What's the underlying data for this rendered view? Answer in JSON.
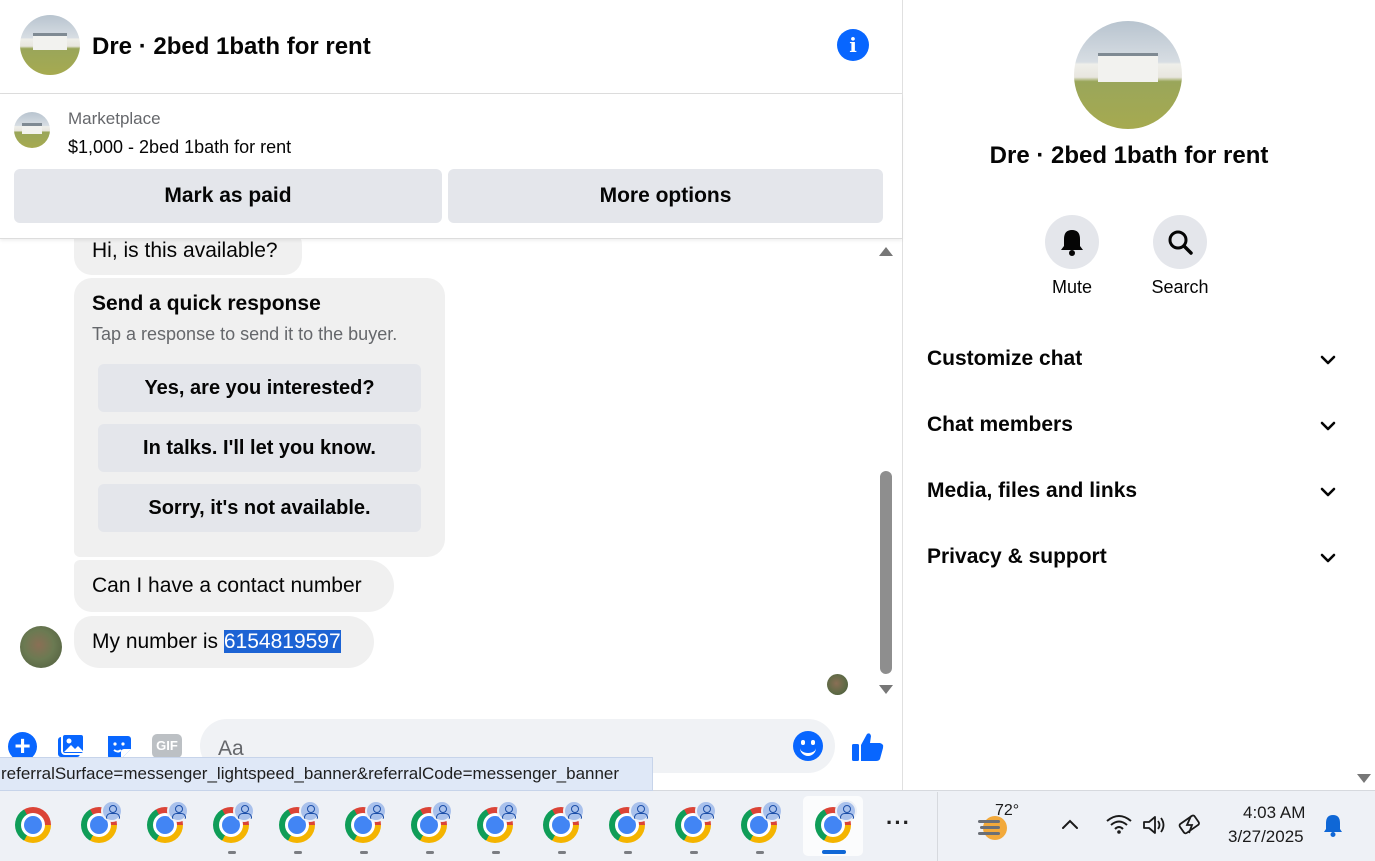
{
  "chat_header": {
    "title": "Dre · 2bed 1bath for rent",
    "info_icon": "info-icon"
  },
  "marketplace": {
    "label": "Marketplace",
    "listing": "$1,000 - 2bed 1bath for rent",
    "mark_paid_label": "Mark as paid",
    "more_options_label": "More options"
  },
  "messages": {
    "first": "Hi, is this available?",
    "quick_response": {
      "title": "Send a quick response",
      "subtitle": "Tap a response to send it to the buyer.",
      "options": [
        "Yes, are you interested?",
        "In talks. I'll let you know.",
        "Sorry, it's not available."
      ]
    },
    "second": "Can I have a contact number",
    "third_prefix": "My number is ",
    "third_highlight": "6154819597"
  },
  "composer": {
    "placeholder": "Aa",
    "gif_label": "GIF",
    "icons": [
      "plus-icon",
      "image-icon",
      "sticker-icon",
      "gif-icon",
      "emoji-icon",
      "thumbs-up-icon"
    ]
  },
  "status_bar_url": "referralSurface=messenger_lightspeed_banner&referralCode=messenger_banner",
  "info_panel": {
    "title": "Dre · 2bed 1bath for rent",
    "mute_label": "Mute",
    "search_label": "Search",
    "sections": [
      "Customize chat",
      "Chat members",
      "Media, files and links",
      "Privacy & support"
    ]
  },
  "taskbar": {
    "temperature": "72°",
    "time": "4:03 AM",
    "date": "3/27/2025",
    "more_label": "···"
  },
  "colors": {
    "accent": "#0866ff",
    "selection": "#1c63d4",
    "bubble": "#f0f0f0",
    "button": "#e4e6eb"
  }
}
